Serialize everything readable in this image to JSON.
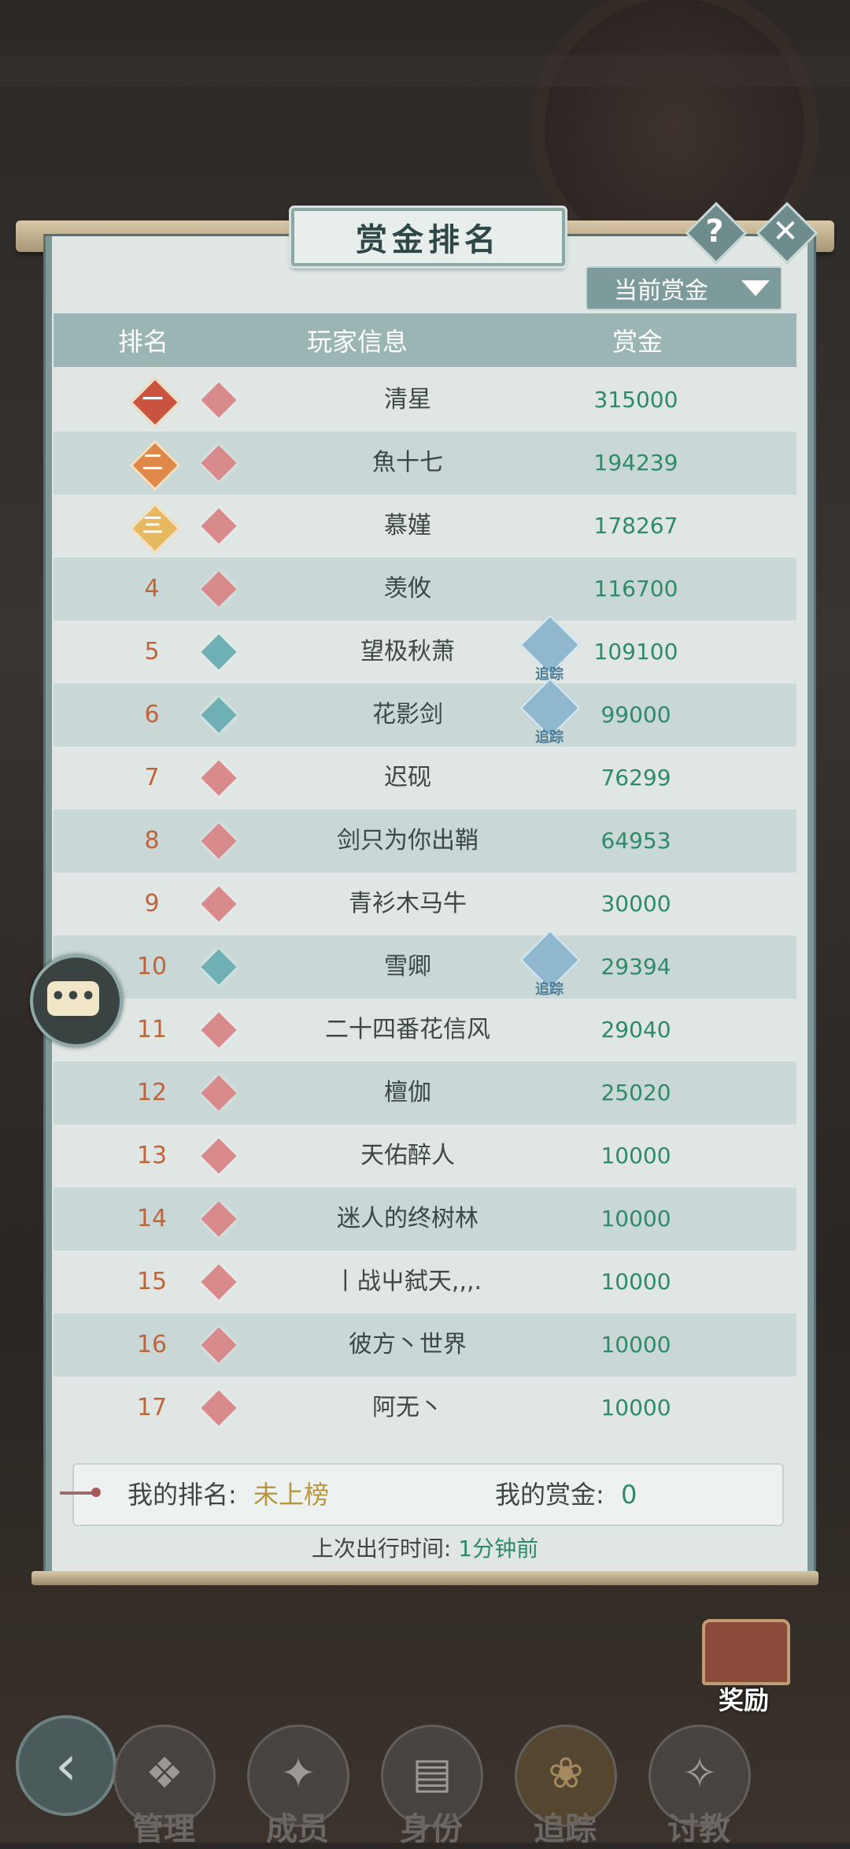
{
  "header": {
    "title": "赏金排名",
    "help_glyph": "?",
    "close_glyph": "✕"
  },
  "filter": {
    "selected": "当前赏金"
  },
  "table": {
    "columns": [
      "排名",
      "玩家信息",
      "赏金"
    ],
    "rows": [
      {
        "rank": "一",
        "badge": "top1",
        "sect": "red",
        "name": "清星",
        "bounty": "315000",
        "tracking": false
      },
      {
        "rank": "二",
        "badge": "top2",
        "sect": "red",
        "name": "魚十七",
        "bounty": "194239",
        "tracking": false
      },
      {
        "rank": "三",
        "badge": "top3",
        "sect": "red",
        "name": "慕嫤",
        "bounty": "178267",
        "tracking": false
      },
      {
        "rank": "4",
        "sect": "red",
        "name": "羡攸",
        "bounty": "116700",
        "tracking": false
      },
      {
        "rank": "5",
        "sect": "teal",
        "name": "望极秋萧",
        "bounty": "109100",
        "tracking": true
      },
      {
        "rank": "6",
        "sect": "teal",
        "name": "花影剑",
        "bounty": "99000",
        "tracking": true
      },
      {
        "rank": "7",
        "sect": "red",
        "name": "迟砚",
        "bounty": "76299",
        "tracking": false
      },
      {
        "rank": "8",
        "sect": "red",
        "name": "剑只为你出鞘",
        "bounty": "64953",
        "tracking": false
      },
      {
        "rank": "9",
        "sect": "red",
        "name": "青衫木马牛",
        "bounty": "30000",
        "tracking": false
      },
      {
        "rank": "10",
        "sect": "teal",
        "name": "雪卿",
        "bounty": "29394",
        "tracking": true
      },
      {
        "rank": "11",
        "sect": "red",
        "name": "二十四番花信风",
        "bounty": "29040",
        "tracking": false
      },
      {
        "rank": "12",
        "sect": "red",
        "name": "檀伽",
        "bounty": "25020",
        "tracking": false
      },
      {
        "rank": "13",
        "sect": "red",
        "name": "天佑醉人",
        "bounty": "10000",
        "tracking": false
      },
      {
        "rank": "14",
        "sect": "red",
        "name": "迷人的终树林",
        "bounty": "10000",
        "tracking": false
      },
      {
        "rank": "15",
        "sect": "red",
        "name": "丨战屮弑天,,,.",
        "bounty": "10000",
        "tracking": false
      },
      {
        "rank": "16",
        "sect": "red",
        "name": "彼方丶世界",
        "bounty": "10000",
        "tracking": false
      },
      {
        "rank": "17",
        "sect": "red",
        "name": "阿无丶",
        "bounty": "10000",
        "tracking": false
      }
    ],
    "track_label": "追踪"
  },
  "my": {
    "rank_label": "我的排名:",
    "rank_value": "未上榜",
    "bounty_label": "我的赏金:",
    "bounty_value": "0"
  },
  "last_trip": {
    "label": "上次出行时间:",
    "value": "1分钟前"
  },
  "reward": {
    "label": "奖励"
  },
  "nav": [
    {
      "label": "管理",
      "icon": "management-icon"
    },
    {
      "label": "成员",
      "icon": "members-icon"
    },
    {
      "label": "身份",
      "icon": "identity-icon"
    },
    {
      "label": "追踪",
      "icon": "tracking-icon",
      "active": true
    },
    {
      "label": "讨教",
      "icon": "challenge-icon"
    }
  ],
  "colors": {
    "bounty_green": "#2f8a6a",
    "rank_orange": "#c0643b",
    "gold": "#b8963f",
    "panel_teal": "#7e9b9b"
  }
}
